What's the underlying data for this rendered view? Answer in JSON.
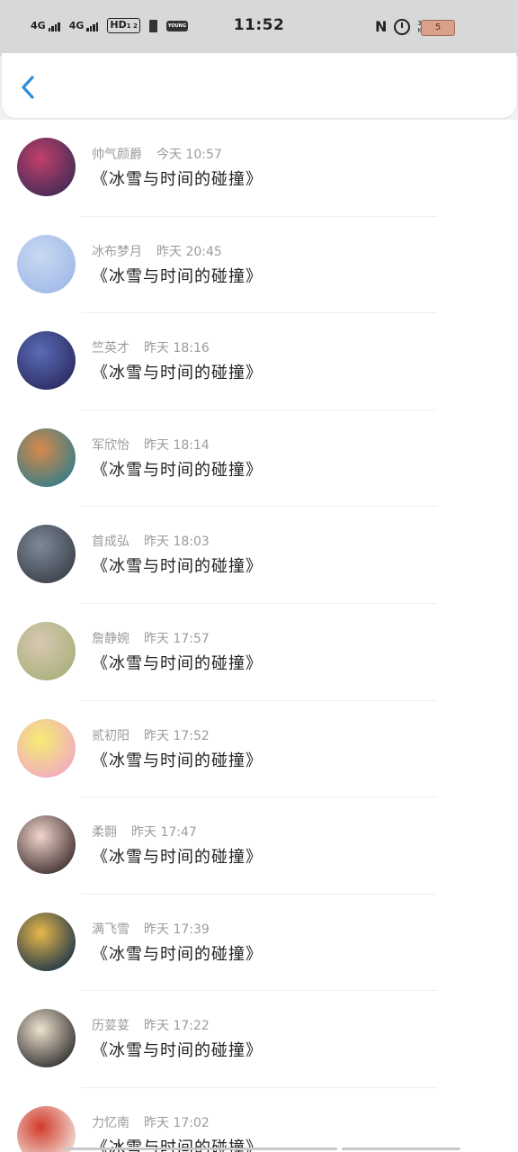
{
  "status_bar": {
    "sim1": "4G",
    "sim2": "4G",
    "hd": "HD",
    "hd_sub": "1 2",
    "young": "YOUNG",
    "time": "11:52",
    "nfc": "N",
    "speed_value": "35.4",
    "speed_unit": "KB/s",
    "battery": "5"
  },
  "header": {
    "back_icon": "chevron-left-icon"
  },
  "colors": {
    "accent": "#2b8fdc",
    "meta": "#9b9b9b",
    "title": "#222222"
  },
  "comments": [
    {
      "name": "帅气颜爵",
      "time": "今天 10:57",
      "text": "《冰雪与时间的碰撞》",
      "avatar_colors": [
        "#c2406b",
        "#3d2a55"
      ]
    },
    {
      "name": "冰布梦月",
      "time": "昨天 20:45",
      "text": "《冰雪与时间的碰撞》",
      "avatar_colors": [
        "#c9d9f2",
        "#9fb8e8"
      ]
    },
    {
      "name": "竺英才",
      "time": "昨天 18:16",
      "text": "《冰雪与时间的碰撞》",
      "avatar_colors": [
        "#5a6bb8",
        "#2a2a5e"
      ]
    },
    {
      "name": "军欣怡",
      "time": "昨天 18:14",
      "text": "《冰雪与时间的碰撞》",
      "avatar_colors": [
        "#d8894a",
        "#2e7d8a"
      ]
    },
    {
      "name": "首成弘",
      "time": "昨天 18:03",
      "text": "《冰雪与时间的碰撞》",
      "avatar_colors": [
        "#7c8a96",
        "#3a3e4a"
      ]
    },
    {
      "name": "詹静婉",
      "time": "昨天 17:57",
      "text": "《冰雪与时间的碰撞》",
      "avatar_colors": [
        "#d8c7b2",
        "#a8b07a"
      ]
    },
    {
      "name": "贰初阳",
      "time": "昨天 17:52",
      "text": "《冰雪与时间的碰撞》",
      "avatar_colors": [
        "#f4ec72",
        "#f2a8c4"
      ]
    },
    {
      "name": "柔翾",
      "time": "昨天 17:47",
      "text": "《冰雪与时间的碰撞》",
      "avatar_colors": [
        "#f2d6cc",
        "#3a2a2a"
      ]
    },
    {
      "name": "满飞雪",
      "time": "昨天 17:39",
      "text": "《冰雪与时间的碰撞》",
      "avatar_colors": [
        "#e8b84a",
        "#16304a"
      ]
    },
    {
      "name": "历荽荽",
      "time": "昨天 17:22",
      "text": "《冰雪与时间的碰撞》",
      "avatar_colors": [
        "#f0e2cf",
        "#2a2a2a"
      ]
    },
    {
      "name": "力忆南",
      "time": "昨天 17:02",
      "text": "《冰雪与时间的碰撞》",
      "avatar_colors": [
        "#d23a2a",
        "#f4ebe4"
      ]
    }
  ]
}
